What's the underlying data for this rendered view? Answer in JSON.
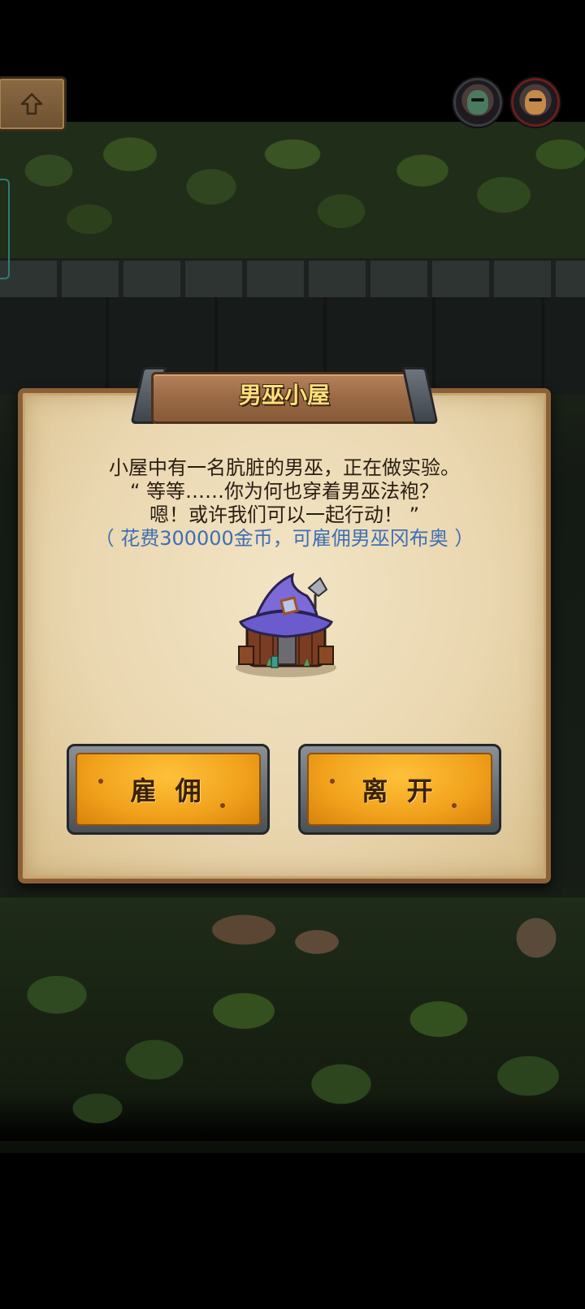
{
  "dialog": {
    "title": "男巫小屋",
    "lines": [
      "小屋中有一名肮脏的男巫，正在做实验。",
      "“ 等等……你为何也穿着男巫法袍？",
      "嗯！或许我们可以一起行动！ ”"
    ],
    "cost_line": "（ 花费300000金币，可雇佣男巫冈布奥 ）",
    "hire_label": "雇 佣",
    "leave_label": "离 开"
  },
  "hud": {
    "back_icon": "up-arrow-icon",
    "avatars": [
      "goblin-avatar-icon",
      "warrior-avatar-icon"
    ]
  },
  "colors": {
    "accent_text": "#3f6fb5",
    "title_text": "#ffe07a",
    "button_face": "#f1a11c"
  }
}
